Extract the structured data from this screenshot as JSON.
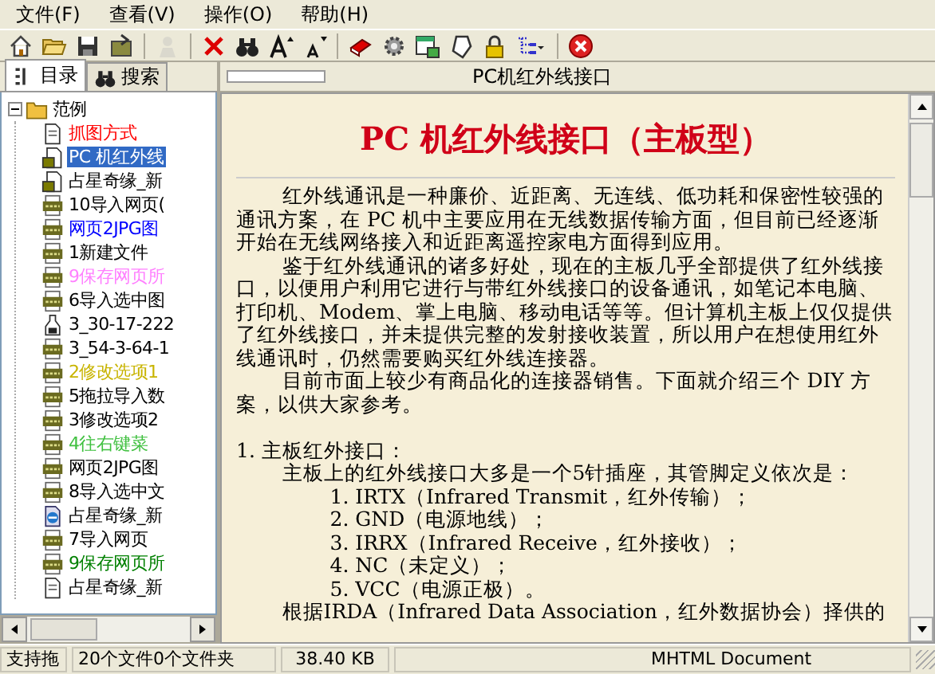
{
  "menu": [
    "文件(F)",
    "查看(V)",
    "操作(O)",
    "帮助(H)"
  ],
  "toolbar": [
    {
      "kind": "home",
      "disabled": false
    },
    {
      "kind": "open",
      "disabled": false
    },
    {
      "kind": "save",
      "disabled": false
    },
    {
      "kind": "export",
      "disabled": false
    },
    {
      "kind": "sep"
    },
    {
      "kind": "person",
      "disabled": true
    },
    {
      "kind": "sep"
    },
    {
      "kind": "delete",
      "disabled": false
    },
    {
      "kind": "find",
      "disabled": false
    },
    {
      "kind": "fontup",
      "disabled": false
    },
    {
      "kind": "fontdown",
      "disabled": false
    },
    {
      "kind": "sep"
    },
    {
      "kind": "book",
      "disabled": false
    },
    {
      "kind": "gear",
      "disabled": false
    },
    {
      "kind": "window",
      "disabled": false
    },
    {
      "kind": "tag",
      "disabled": false
    },
    {
      "kind": "lock",
      "disabled": false
    },
    {
      "kind": "tree",
      "disabled": false
    },
    {
      "kind": "sep"
    },
    {
      "kind": "close",
      "disabled": false
    }
  ],
  "tabs": [
    {
      "label": "目录",
      "kind": "list",
      "selected": true
    },
    {
      "label": "搜索",
      "kind": "find",
      "selected": false
    }
  ],
  "tree": {
    "label": "范例",
    "expanded": true,
    "children": [
      {
        "label": "抓图方式",
        "kind": "page",
        "color": "#ff0000",
        "selected": false
      },
      {
        "label": "PC 机红外线",
        "kind": "photo",
        "selected": true
      },
      {
        "label": "占星奇缘_新",
        "kind": "photo",
        "color": "#000000",
        "selected": false
      },
      {
        "label": "10导入网页(",
        "kind": "jpg",
        "color": "#000000",
        "selected": false
      },
      {
        "label": "网页2JPG图",
        "kind": "jpg",
        "color": "#0000ff",
        "selected": false
      },
      {
        "label": "1新建文件",
        "kind": "jpg",
        "color": "#000000",
        "selected": false
      },
      {
        "label": "9保存网页所",
        "kind": "jpg",
        "color": "#ff80ff",
        "selected": false
      },
      {
        "label": "6导入选中图",
        "kind": "jpg",
        "color": "#000000",
        "selected": false
      },
      {
        "label": "3_30-17-222",
        "kind": "bottle",
        "color": "#000000",
        "selected": false
      },
      {
        "label": "3_54-3-64-1",
        "kind": "jpg",
        "color": "#000000",
        "selected": false
      },
      {
        "label": "2修改选项1",
        "kind": "jpg",
        "color": "#c8b400",
        "selected": false
      },
      {
        "label": "5拖拉导入数",
        "kind": "jpg",
        "color": "#000000",
        "selected": false
      },
      {
        "label": "3修改选项2",
        "kind": "jpg",
        "color": "#000000",
        "selected": false
      },
      {
        "label": "4往右键菜",
        "kind": "jpg",
        "color": "#40c040",
        "selected": false
      },
      {
        "label": "网页2JPG图",
        "kind": "jpg",
        "color": "#000000",
        "selected": false
      },
      {
        "label": "8导入选中文",
        "kind": "jpg",
        "color": "#000000",
        "selected": false
      },
      {
        "label": "占星奇缘_新",
        "kind": "ie",
        "color": "#000000",
        "selected": false
      },
      {
        "label": "7导入网页",
        "kind": "jpg",
        "color": "#000000",
        "selected": false
      },
      {
        "label": "9保存网页所",
        "kind": "jpg",
        "color": "#008000",
        "selected": false
      },
      {
        "label": "占星奇缘_新",
        "kind": "page",
        "color": "#000000",
        "selected": false
      }
    ]
  },
  "document": {
    "header": "PC机红外线接口",
    "title": "PC 机红外线接口（主板型）",
    "blocks": [
      {
        "kind": "para",
        "text": "红外线通讯是一种廉价、近距离、无连线、低功耗和保密性较强的通讯方案，在 PC 机中主要应用在无线数据传输方面，但目前已经逐渐开始在无线网络接入和近距离遥控家电方面得到应用。"
      },
      {
        "kind": "para",
        "text": "鉴于红外线通讯的诸多好处，现在的主板几乎全部提供了红外线接口，以便用户利用它进行与带红外线接口的设备通讯，如笔记本电脑、打印机、Modem、掌上电脑、移动电话等等。但计算机主板上仅仅提供了红外线接口，并未提供完整的发射接收装置，所以用户在想使用红外线通讯时，仍然需要购买红外线连接器。"
      },
      {
        "kind": "para",
        "text": "目前市面上较少有商品化的连接器销售。下面就介绍三个 DIY 方案，以供大家参考。"
      },
      {
        "kind": "blank"
      },
      {
        "kind": "heading",
        "text": "1. 主板红外接口："
      },
      {
        "kind": "sub",
        "text": "主板上的红外线接口大多是一个5针插座，其管脚定义依次是："
      },
      {
        "kind": "item",
        "text": "1. IRTX（Infrared Transmit，红外传输）；"
      },
      {
        "kind": "item",
        "text": "2. GND（电源地线）；"
      },
      {
        "kind": "item",
        "text": "3. IRRX（Infrared Receive，红外接收）；"
      },
      {
        "kind": "item",
        "text": "4. NC（未定义）；"
      },
      {
        "kind": "item",
        "text": "5. VCC（电源正极）。"
      },
      {
        "kind": "sub",
        "text": "根据IRDA（Infrared Data Association，红外数据协会）择供的"
      }
    ]
  },
  "status_bar": [
    "支持拖",
    "20个文件0个文件夹",
    "38.40 KB",
    "MHTML Document"
  ]
}
